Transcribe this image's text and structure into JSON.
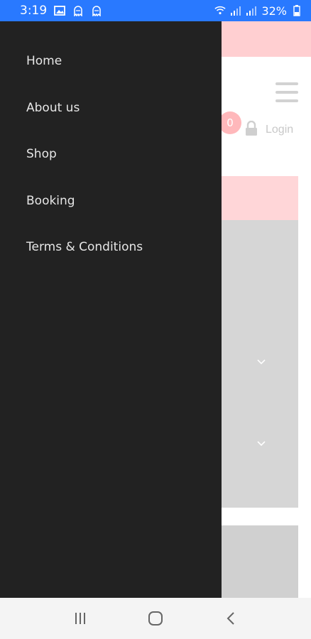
{
  "status_bar": {
    "time": "3:19",
    "battery": "32%",
    "left_icons": [
      "image-icon",
      "ghost-icon",
      "ghost-icon"
    ],
    "right_icons": [
      "wifi-icon",
      "signal-icon",
      "signal-icon",
      "battery-icon"
    ]
  },
  "drawer": {
    "items": [
      {
        "label": "Home"
      },
      {
        "label": "About us"
      },
      {
        "label": "Shop"
      },
      {
        "label": "Booking"
      },
      {
        "label": "Terms & Conditions"
      }
    ]
  },
  "background_page": {
    "cart_count": "0",
    "login_label": "Login"
  },
  "nav_bar": {
    "buttons": [
      "recents-icon",
      "home-icon",
      "back-icon"
    ]
  },
  "colors": {
    "status_bar": "#2979ff",
    "drawer_bg": "#222222",
    "drawer_text": "#e6e6e6",
    "accent_pink": "#ffcfd1"
  }
}
